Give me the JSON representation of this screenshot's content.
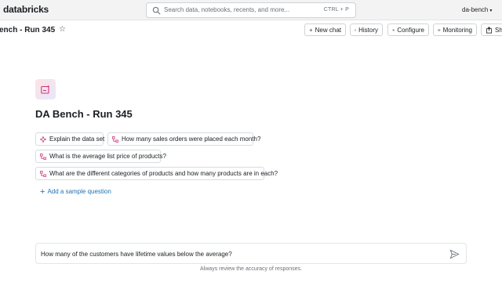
{
  "app": {
    "logo_text": "databricks",
    "workspace": "da-bench"
  },
  "search": {
    "placeholder": "Search data, notebooks, recents, and more...",
    "shortcut": "CTRL + P"
  },
  "space": {
    "breadcrumb_title": "ench - Run 345",
    "title": "DA Bench - Run 345"
  },
  "toolbar": {
    "new_chat": "New chat",
    "history": "History",
    "configure": "Configure",
    "monitoring": "Monitoring",
    "share": "Sha"
  },
  "sample_questions": [
    "Explain the data set",
    "How many sales orders were placed each month?",
    "What is the average list price of products?",
    "What are the different categories of products and how many products are in each?"
  ],
  "add_sample_label": "Add a sample question",
  "chat": {
    "input_value": "How many of the customers have lifetime values below the average?",
    "disclaimer": "Always review the accuracy of responses."
  },
  "colors": {
    "accent": "#2272b4",
    "icon_pink": "#d0367b",
    "topbar": "#f3f3f3"
  },
  "icons": [
    "search-icon",
    "star-icon",
    "plus-icon",
    "history-icon",
    "gear-icon",
    "eye-icon",
    "share-icon",
    "sparkle-icon",
    "flow-icon",
    "send-icon"
  ]
}
